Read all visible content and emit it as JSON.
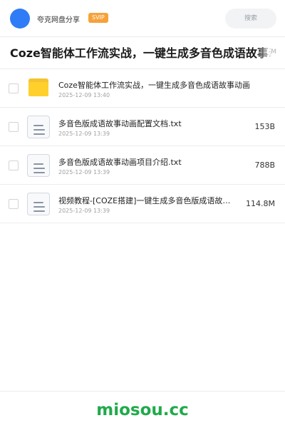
{
  "header": {
    "user_name": "夸克网盘分享",
    "badge": "SVIP",
    "search_placeholder": "搜索"
  },
  "share": {
    "title": "Coze智能体工作流实战，一键生成多音色成语故事动画"
  },
  "files": [
    {
      "name": "Coze智能体工作流实战，一键生成多音色成语故事动画",
      "date": "2025-12-09 13:40",
      "size": "",
      "type": "folder"
    },
    {
      "name": "多音色版成语故事动画配置文档.txt",
      "date": "2025-12-09 13:39",
      "size": "153B",
      "type": "file"
    },
    {
      "name": "多音色版成语故事动画项目介绍.txt",
      "date": "2025-12-09 13:39",
      "size": "788B",
      "type": "file"
    },
    {
      "name": "视频教程-[COZE搭建]一键生成多音色版成语故事动画",
      "date": "2025-12-09 13:39",
      "size": "114.8M",
      "type": "file"
    }
  ],
  "footer": {
    "watermark": "miosou.cc"
  },
  "colors": {
    "avatar": "#2f7cf6",
    "badge": "#f5a23c",
    "folder": "#ffd02b",
    "watermark": "#1faa4a"
  }
}
